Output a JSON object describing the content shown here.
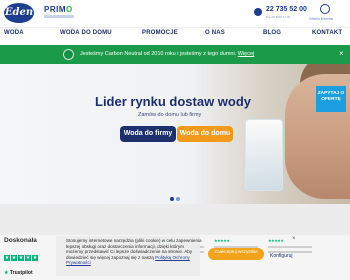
{
  "header": {
    "logo_eden": "Eden",
    "logo_primo_a": "PRIM",
    "logo_primo_b": "O",
    "phone_number": "22 735 52 00",
    "phone_hours": "Pon-Pt 8:00-17:00",
    "user_label": "Strefa Klienta"
  },
  "nav": {
    "items": [
      "WODA",
      "WODA DO DOMU",
      "PROMOCJE",
      "O NAS",
      "BLOG",
      "KONTAKT"
    ]
  },
  "banner": {
    "text": "Jesteśmy Carbon Neutral od 2010 roku i jesteśmy z tego dumni.",
    "link": "Więcej",
    "close": "×",
    "color": "#1b9a49"
  },
  "hero": {
    "title": "Lider rynku dostaw wody",
    "subtitle": "Zamów do domu lub firmy",
    "btn_firm": "Woda do firmy",
    "btn_home": "Woda do domu",
    "offer_tab": "ZAPYTAJ O OFERTĘ",
    "slides": 2,
    "active_slide": 1
  },
  "reviews": {
    "title": "Doskonała",
    "stars": 5,
    "trustpilot": "Trustpilot"
  },
  "cookie": {
    "text": "Stosujemy internetowe narzędzia (pliki cookie) w celu zapewnienia lepszej obsługi oraz dostarczenia informacji, dzięki którym możemy przedstawić Ci lepsze doświadczenie na stronie. Aby dowiedzieć się więcej zapoznaj się z naszą ",
    "policy_link": "Polityką Ochrony Prywatności",
    "accept": "Zaakceptuj wszystkie",
    "configure": "Konfiguruj",
    "close": "×"
  },
  "colors": {
    "navy": "#1d2f6f",
    "orange": "#f39a1c",
    "green": "#1b9a49",
    "blue_tab": "#1c9ee0",
    "trustpilot_green": "#00b67a"
  },
  "icons": [
    "phone-icon",
    "user-icon",
    "carbon-neutral-badge-icon",
    "star-icon",
    "close-icon"
  ]
}
